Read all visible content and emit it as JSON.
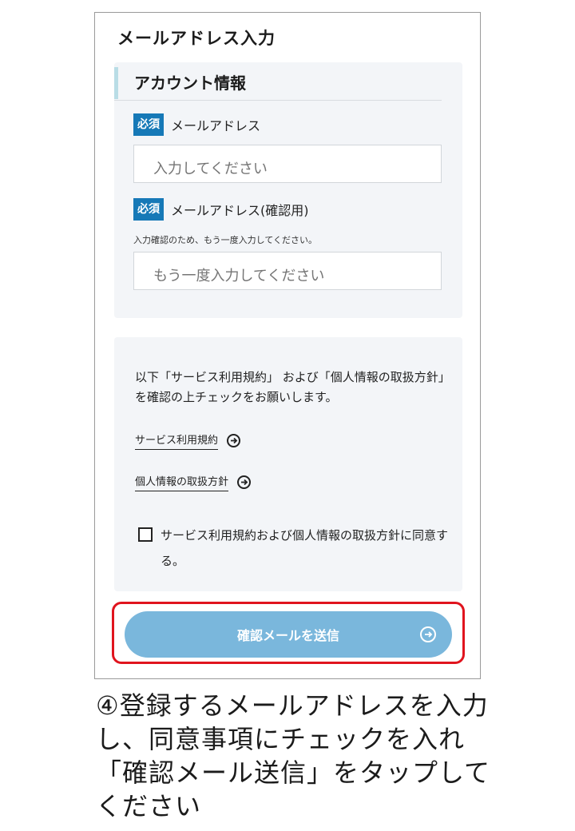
{
  "header": {
    "title": "メールアドレス入力"
  },
  "account_section": {
    "heading": "アカウント情報",
    "email": {
      "required_badge": "必須",
      "label": "メールアドレス",
      "placeholder": "入力してください"
    },
    "email_confirm": {
      "required_badge": "必須",
      "label": "メールアドレス(確認用)",
      "note": "入力確認のため、もう一度入力してください。",
      "placeholder": "もう一度入力してください"
    }
  },
  "agreement_section": {
    "text": "以下「サービス利用規約」 および「個人情報の取扱方針」を確認の上チェックをお願いします。",
    "links": [
      {
        "label": "サービス利用規約"
      },
      {
        "label": "個人情報の取扱方針"
      }
    ],
    "checkbox_label": "サービス利用規約および個人情報の取扱方針に同意する。",
    "checkbox_checked": false
  },
  "submit": {
    "label": "確認メールを送信"
  },
  "caption": "④登録するメールアドレスを入力し、同意事項にチェックを入れ「確認メール送信」をタップしてください",
  "colors": {
    "badge": "#1679b7",
    "button": "#7ab7dc",
    "highlight": "#e0141e",
    "card_bg": "#f3f5f8"
  }
}
